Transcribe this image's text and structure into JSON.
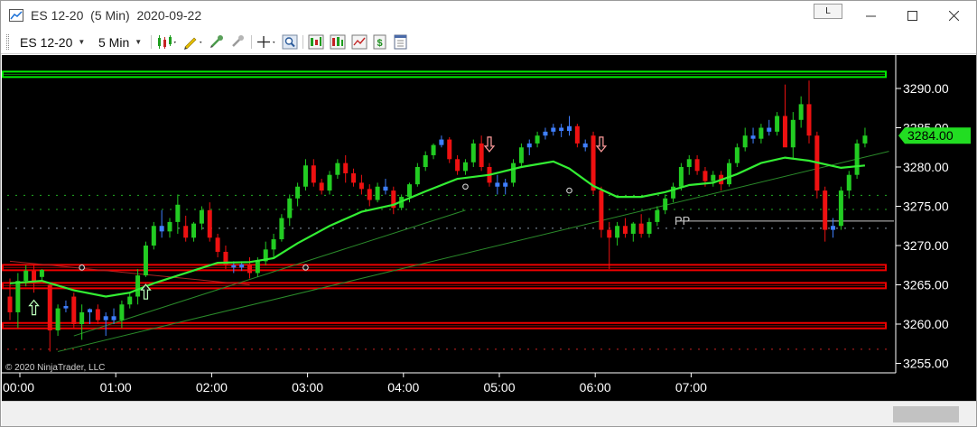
{
  "window": {
    "title": "ES 12-20  (5 Min)  2020-09-22",
    "link_label": "L",
    "min_icon": "minimize-icon",
    "max_icon": "maximize-icon",
    "close_icon": "close-icon"
  },
  "toolbar": {
    "instrument": "ES 12-20",
    "interval": "5 Min",
    "icons": [
      "bar-style-icon",
      "draw-tool-icon",
      "attach-icon",
      "detach-icon",
      "crosshair-icon",
      "zoom-icon",
      "strategy-icon",
      "indicators-icon",
      "chart-trader-icon",
      "data-box-icon",
      "properties-icon"
    ]
  },
  "colors": {
    "background": "#000000",
    "up_candle": "#22cc22",
    "down_candle": "#ee1111",
    "neutral_candle": "#3f7fff",
    "ma_line": "#33ee33",
    "level_green": "#00ee00",
    "level_red": "#ee0000",
    "price_badge": "#22dd22"
  },
  "chart_data": {
    "type": "candlestick",
    "symbol": "ES 12-20",
    "interval": "5 Min",
    "date": "2020-09-22",
    "copyright": "© 2020 NinjaTrader, LLC",
    "y_range": [
      3254,
      3296
    ],
    "y_ticks": [
      3255,
      3260,
      3265,
      3270,
      3275,
      3280,
      3285,
      3290
    ],
    "y_tick_labels": [
      "3255.00",
      "3260.00",
      "3265.00",
      "3270.00",
      "3275.00",
      "3280.00",
      "3285.00",
      "3290.00"
    ],
    "x_ticks": [
      "00:00",
      "01:00",
      "02:00",
      "03:00",
      "04:00",
      "05:00",
      "06:00",
      "07:00"
    ],
    "last_price": 3284.0,
    "last_price_label": "3284.00",
    "pivot_label": "PP",
    "pivot_price": 3273.0,
    "horizontal_levels": [
      {
        "price": 3291.8,
        "color": "green"
      },
      {
        "price": 3267.2,
        "color": "red"
      },
      {
        "price": 3264.9,
        "color": "red"
      },
      {
        "price": 3259.8,
        "color": "red"
      }
    ],
    "candles": [
      [
        3263.5,
        3265.8,
        3260.5,
        3261.5
      ],
      [
        3261.5,
        3266.5,
        3259.5,
        3265.5
      ],
      [
        3265.5,
        3267.5,
        3264.8,
        3266.8
      ],
      [
        3266.8,
        3267.5,
        3264.0,
        3265.2
      ],
      [
        3266.0,
        3267.0,
        3265.5,
        3266.9
      ],
      [
        3265.0,
        3265.3,
        3256.5,
        3259.2
      ],
      [
        3259.2,
        3262.5,
        3258.5,
        3262.0
      ],
      [
        3262.0,
        3263.0,
        3261.5,
        3262.3
      ],
      [
        3263.5,
        3264.0,
        3259.5,
        3260.0
      ],
      [
        3260.0,
        3262.5,
        3258.0,
        3261.5
      ],
      [
        3261.5,
        3262.0,
        3260.0,
        3261.9
      ],
      [
        3261.9,
        3262.5,
        3260.0,
        3260.5
      ],
      [
        3260.5,
        3261.5,
        3258.5,
        3261.0
      ],
      [
        3261.0,
        3262.0,
        3260.0,
        3260.5
      ],
      [
        3260.5,
        3263.0,
        3259.5,
        3262.5
      ],
      [
        3262.5,
        3264.0,
        3262.0,
        3263.5
      ],
      [
        3263.5,
        3267.0,
        3262.5,
        3266.2
      ],
      [
        3266.2,
        3270.5,
        3266.0,
        3270.0
      ],
      [
        3270.0,
        3273.0,
        3269.5,
        3272.5
      ],
      [
        3272.5,
        3274.5,
        3271.0,
        3271.8
      ],
      [
        3271.8,
        3273.5,
        3271.0,
        3273.0
      ],
      [
        3273.0,
        3276.5,
        3271.5,
        3275.2
      ],
      [
        3272.5,
        3273.8,
        3270.5,
        3271.0
      ],
      [
        3271.0,
        3273.0,
        3270.5,
        3272.8
      ],
      [
        3272.8,
        3275.0,
        3272.0,
        3274.5
      ],
      [
        3274.5,
        3275.5,
        3270.5,
        3271.0
      ],
      [
        3271.0,
        3271.5,
        3268.5,
        3269.2
      ],
      [
        3269.2,
        3270.0,
        3267.0,
        3267.5
      ],
      [
        3267.5,
        3268.0,
        3266.5,
        3267.2
      ],
      [
        3267.2,
        3268.0,
        3266.8,
        3267.6
      ],
      [
        3267.6,
        3268.5,
        3265.8,
        3266.5
      ],
      [
        3266.5,
        3268.5,
        3266.0,
        3268.0
      ],
      [
        3268.0,
        3270.5,
        3267.5,
        3269.5
      ],
      [
        3269.5,
        3271.5,
        3268.5,
        3270.8
      ],
      [
        3270.8,
        3274.0,
        3270.5,
        3273.5
      ],
      [
        3273.5,
        3276.5,
        3272.5,
        3276.0
      ],
      [
        3276.0,
        3278.0,
        3275.0,
        3277.5
      ],
      [
        3277.5,
        3281.0,
        3277.0,
        3280.2
      ],
      [
        3280.2,
        3281.0,
        3277.5,
        3278.0
      ],
      [
        3278.0,
        3278.5,
        3276.5,
        3277.0
      ],
      [
        3277.0,
        3279.5,
        3276.5,
        3279.0
      ],
      [
        3279.0,
        3281.0,
        3278.5,
        3280.5
      ],
      [
        3280.5,
        3281.5,
        3278.0,
        3279.2
      ],
      [
        3279.2,
        3279.8,
        3277.5,
        3278.0
      ],
      [
        3278.0,
        3279.0,
        3276.5,
        3277.2
      ],
      [
        3277.2,
        3277.8,
        3275.0,
        3275.8
      ],
      [
        3275.8,
        3278.0,
        3275.5,
        3277.5
      ],
      [
        3277.5,
        3278.5,
        3276.5,
        3277.0
      ],
      [
        3277.0,
        3277.5,
        3274.0,
        3274.8
      ],
      [
        3274.8,
        3276.5,
        3274.5,
        3276.2
      ],
      [
        3276.2,
        3278.0,
        3275.5,
        3277.8
      ],
      [
        3277.8,
        3280.5,
        3277.5,
        3280.0
      ],
      [
        3280.0,
        3282.0,
        3279.5,
        3281.5
      ],
      [
        3281.5,
        3283.0,
        3281.0,
        3282.8
      ],
      [
        3282.8,
        3284.0,
        3282.5,
        3283.5
      ],
      [
        3283.5,
        3283.8,
        3280.5,
        3281.0
      ],
      [
        3281.0,
        3281.5,
        3279.0,
        3279.5
      ],
      [
        3279.5,
        3281.0,
        3279.0,
        3280.6
      ],
      [
        3280.6,
        3283.5,
        3280.0,
        3283.0
      ],
      [
        3283.0,
        3284.0,
        3279.5,
        3280.0
      ],
      [
        3280.0,
        3280.5,
        3277.5,
        3278.0
      ],
      [
        3278.0,
        3279.0,
        3276.5,
        3277.5
      ],
      [
        3277.5,
        3278.5,
        3276.5,
        3278.0
      ],
      [
        3278.0,
        3281.0,
        3277.5,
        3280.5
      ],
      [
        3280.5,
        3283.0,
        3280.0,
        3282.5
      ],
      [
        3282.5,
        3283.5,
        3281.5,
        3283.0
      ],
      [
        3283.0,
        3284.5,
        3282.5,
        3284.0
      ],
      [
        3284.0,
        3285.0,
        3283.5,
        3284.5
      ],
      [
        3284.5,
        3285.5,
        3284.0,
        3285.0
      ],
      [
        3285.0,
        3285.5,
        3283.8,
        3284.6
      ],
      [
        3284.6,
        3286.5,
        3284.0,
        3285.2
      ],
      [
        3285.2,
        3285.5,
        3282.5,
        3283.0
      ],
      [
        3283.0,
        3283.5,
        3282.0,
        3282.5
      ],
      [
        3284.0,
        3284.5,
        3276.5,
        3277.0
      ],
      [
        3277.0,
        3277.5,
        3271.0,
        3272.0
      ],
      [
        3272.0,
        3273.0,
        3267.0,
        3271.0
      ],
      [
        3271.0,
        3273.0,
        3270.0,
        3272.5
      ],
      [
        3272.5,
        3273.5,
        3271.0,
        3271.5
      ],
      [
        3271.5,
        3273.0,
        3270.5,
        3272.8
      ],
      [
        3272.8,
        3274.0,
        3271.0,
        3271.5
      ],
      [
        3271.5,
        3273.5,
        3271.0,
        3273.0
      ],
      [
        3273.0,
        3275.0,
        3272.5,
        3274.5
      ],
      [
        3274.5,
        3276.5,
        3274.0,
        3276.0
      ],
      [
        3276.0,
        3278.0,
        3275.5,
        3277.5
      ],
      [
        3277.5,
        3280.5,
        3277.0,
        3280.0
      ],
      [
        3280.0,
        3281.5,
        3279.0,
        3281.0
      ],
      [
        3281.0,
        3281.5,
        3279.0,
        3279.5
      ],
      [
        3279.5,
        3280.0,
        3277.5,
        3278.2
      ],
      [
        3278.2,
        3279.5,
        3277.5,
        3279.0
      ],
      [
        3279.0,
        3279.5,
        3277.0,
        3277.8
      ],
      [
        3277.8,
        3281.0,
        3277.5,
        3280.5
      ],
      [
        3280.5,
        3283.0,
        3280.0,
        3282.5
      ],
      [
        3282.5,
        3285.0,
        3282.0,
        3284.0
      ],
      [
        3284.0,
        3285.0,
        3283.0,
        3283.6
      ],
      [
        3283.6,
        3285.5,
        3283.0,
        3285.0
      ],
      [
        3285.0,
        3286.0,
        3284.0,
        3284.5
      ],
      [
        3284.5,
        3287.0,
        3284.0,
        3286.5
      ],
      [
        3286.5,
        3290.5,
        3285.0,
        3282.5
      ],
      [
        3282.5,
        3287.0,
        3281.0,
        3286.0
      ],
      [
        3286.0,
        3289.0,
        3285.0,
        3288.0
      ],
      [
        3288.0,
        3291.0,
        3283.0,
        3284.0
      ],
      [
        3284.0,
        3284.5,
        3276.0,
        3277.0
      ],
      [
        3277.0,
        3277.5,
        3270.5,
        3272.0
      ],
      [
        3272.0,
        3273.5,
        3271.0,
        3272.5
      ],
      [
        3272.5,
        3277.5,
        3272.0,
        3277.0
      ],
      [
        3277.0,
        3279.5,
        3276.0,
        3279.0
      ],
      [
        3279.0,
        3283.5,
        3278.5,
        3283.0
      ],
      [
        3283.0,
        3285.0,
        3282.5,
        3284.0
      ]
    ],
    "moving_average": [
      [
        0,
        3265.2
      ],
      [
        4,
        3265.5
      ],
      [
        8,
        3264.3
      ],
      [
        12,
        3263.5
      ],
      [
        15,
        3264.0
      ],
      [
        18,
        3265.2
      ],
      [
        22,
        3266.5
      ],
      [
        26,
        3267.8
      ],
      [
        30,
        3267.9
      ],
      [
        33,
        3268.4
      ],
      [
        36,
        3270.3
      ],
      [
        40,
        3272.5
      ],
      [
        44,
        3274.3
      ],
      [
        48,
        3275.2
      ],
      [
        52,
        3276.9
      ],
      [
        56,
        3278.5
      ],
      [
        60,
        3279.0
      ],
      [
        64,
        3280.0
      ],
      [
        68,
        3280.7
      ],
      [
        70,
        3279.8
      ],
      [
        73,
        3277.6
      ],
      [
        76,
        3276.2
      ],
      [
        79,
        3276.2
      ],
      [
        82,
        3276.8
      ],
      [
        85,
        3277.7
      ],
      [
        88,
        3278.0
      ],
      [
        91,
        3279.1
      ],
      [
        94,
        3280.5
      ],
      [
        97,
        3281.2
      ],
      [
        100,
        3280.8
      ],
      [
        104,
        3279.9
      ],
      [
        107,
        3280.2
      ]
    ],
    "arrows": [
      {
        "index": 3,
        "dir": "up",
        "price": 3262.0
      },
      {
        "index": 17,
        "dir": "up",
        "price": 3264.0
      },
      {
        "index": 60,
        "dir": "down",
        "price": 3283.0
      },
      {
        "index": 74,
        "dir": "down",
        "price": 3283.0
      }
    ],
    "markers": [
      {
        "index": 9,
        "price": 3267.2
      },
      {
        "index": 37,
        "price": 3267.2
      },
      {
        "index": 57,
        "price": 3277.5
      },
      {
        "index": 70,
        "price": 3277.0
      }
    ],
    "trend_lines": [
      {
        "from": [
          6,
          3256.5
        ],
        "to": [
          110,
          3282.0
        ]
      },
      {
        "from": [
          8,
          3258.5
        ],
        "to": [
          57,
          3274.5
        ]
      },
      {
        "from": [
          0,
          3268.0
        ],
        "to": [
          30,
          3265.0
        ]
      }
    ],
    "dotted_levels": [
      {
        "price": 3256.8,
        "color": "#cc2222"
      },
      {
        "price": 3272.2,
        "color": "#8899aa"
      },
      {
        "price": 3274.6,
        "color": "#22aa22"
      },
      {
        "price": 3276.4,
        "color": "#22aa22"
      }
    ]
  }
}
